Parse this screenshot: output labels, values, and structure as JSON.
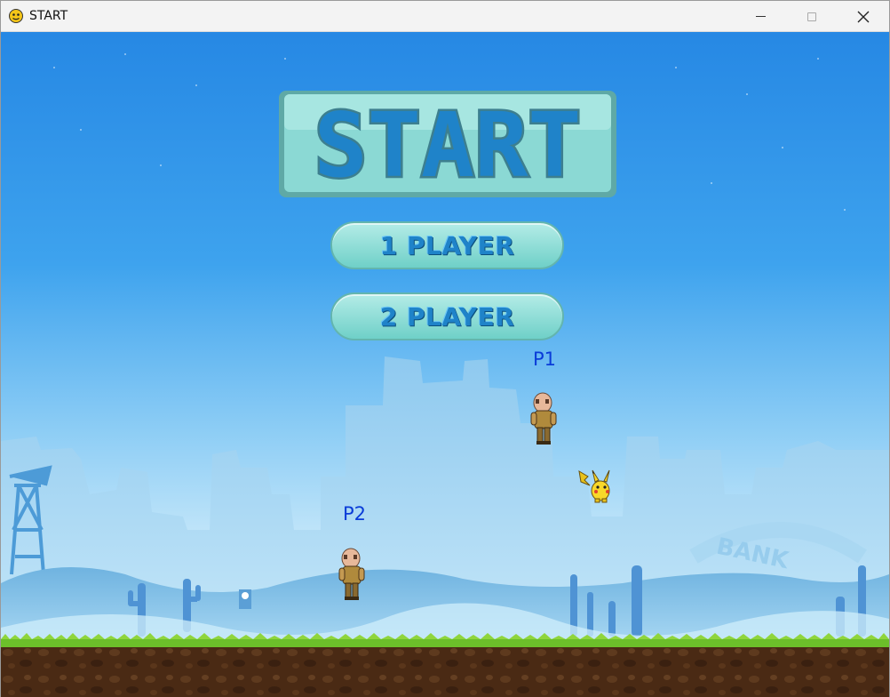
{
  "window": {
    "title": "START",
    "controls": [
      "minimize",
      "maximize",
      "close"
    ]
  },
  "menu": {
    "logo_text": "START",
    "one_player_label": "1 PLAYER",
    "two_player_label": "2 PLAYER"
  },
  "scene": {
    "p1_label": "P1",
    "p2_label": "P2",
    "background": "sky-ruined-city",
    "sign_text": "BANK"
  },
  "colors": {
    "sky_top": "#2a8de8",
    "sky_bottom": "#eaf7fd",
    "button_fill": "#8fdcd4",
    "button_text": "#1f83c9",
    "label_blue": "#0a3cd8",
    "grass": "#6cbf2a",
    "dirt": "#4a2a14"
  }
}
